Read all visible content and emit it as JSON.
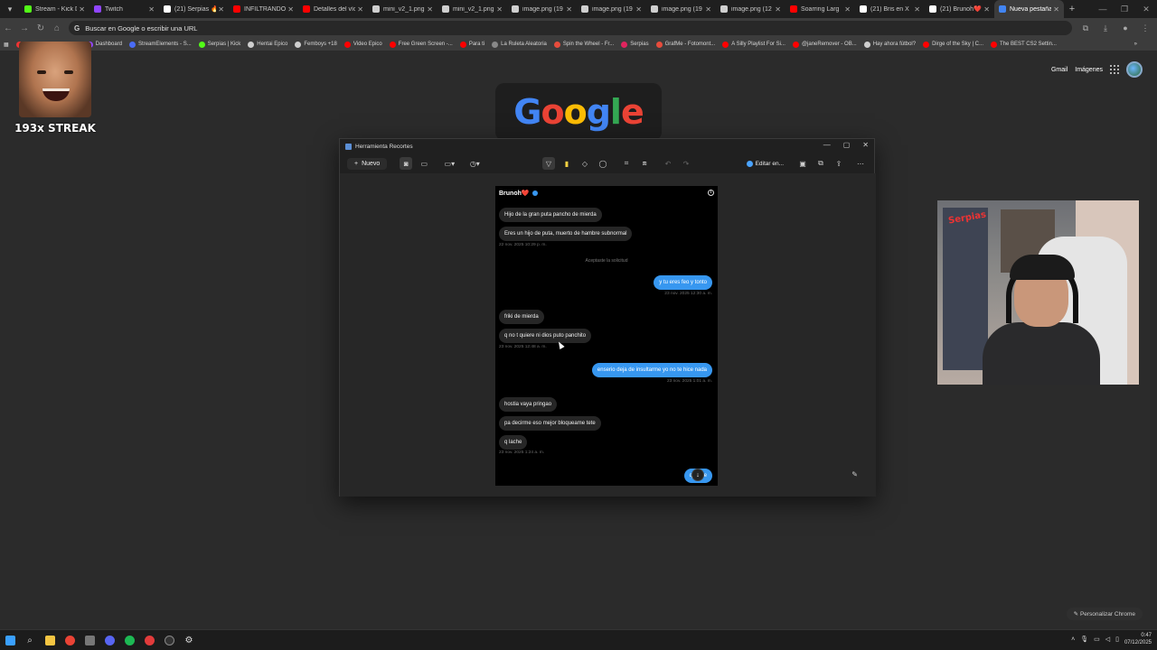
{
  "browser": {
    "tabs": [
      {
        "title": "Stream - Kick D",
        "color": "#53fc18",
        "active": false
      },
      {
        "title": "Twitch",
        "color": "#9146ff",
        "active": false
      },
      {
        "title": "(21) Serpias 🔥",
        "color": "#ffffff",
        "active": false
      },
      {
        "title": "INFILTRANDO",
        "color": "#ff0000",
        "active": false
      },
      {
        "title": "Detalles del víd",
        "color": "#ff0000",
        "active": false
      },
      {
        "title": "mini_v2_1.png",
        "color": "#cfcfcf",
        "active": false
      },
      {
        "title": "mini_v2_1.png",
        "color": "#cfcfcf",
        "active": false
      },
      {
        "title": "image.png (19",
        "color": "#cfcfcf",
        "active": false
      },
      {
        "title": "image.png (19",
        "color": "#cfcfcf",
        "active": false
      },
      {
        "title": "image.png (19",
        "color": "#cfcfcf",
        "active": false
      },
      {
        "title": "image.png (12",
        "color": "#cfcfcf",
        "active": false
      },
      {
        "title": "Soarring Larg",
        "color": "#ff0000",
        "active": false
      },
      {
        "title": "(21) Bris en X",
        "color": "#ffffff",
        "active": false
      },
      {
        "title": "(21) Brunoh❤️",
        "color": "#ffffff",
        "active": false
      },
      {
        "title": "Nueva pestaña",
        "color": "#4285f4",
        "active": true
      }
    ],
    "omnibox_placeholder": "Buscar en Google o escribir una URL",
    "bookmarks": [
      {
        "label": "Dashboard",
        "color": "#9146ff"
      },
      {
        "label": "StreamElements - S...",
        "color": "#4a6cf7"
      },
      {
        "label": "Serpias | Kick",
        "color": "#53fc18"
      },
      {
        "label": "Hentai Epico",
        "color": "#cfcfcf"
      },
      {
        "label": "Femboys +18",
        "color": "#cfcfcf"
      },
      {
        "label": "Video Epico",
        "color": "#ff0000"
      },
      {
        "label": "Free Green Screen -...",
        "color": "#ff0000"
      },
      {
        "label": "Para ti",
        "color": "#ff0000"
      },
      {
        "label": "La Ruleta Aleatoria",
        "color": "#888888"
      },
      {
        "label": "Spin the Wheel - Fr...",
        "color": "#e74c3c"
      },
      {
        "label": "Serpias",
        "color": "#e0245e"
      },
      {
        "label": "GrafMe - Fotomont...",
        "color": "#e74c3c"
      },
      {
        "label": "A Silly Playlist For Si...",
        "color": "#ff0000"
      },
      {
        "label": "@janeRemover - OB...",
        "color": "#ff0000"
      },
      {
        "label": "Hay ahora fútbol?",
        "color": "#cfcfcf"
      },
      {
        "label": "Dirge of the Sky | C...",
        "color": "#ff0000"
      },
      {
        "label": "The BEST CS2 Settin...",
        "color": "#ff0000"
      }
    ]
  },
  "ntp": {
    "gmail": "Gmail",
    "images": "Imágenes",
    "logo": "Google",
    "customize": "Personalizar Chrome"
  },
  "overlay": {
    "streak": "193x STREAK",
    "webcam_poster": "Serpias"
  },
  "snip": {
    "title": "Herramienta Recortes",
    "new_label": "Nuevo",
    "edit_label": "Editar en..."
  },
  "chat": {
    "username": "Brunoh❤️",
    "messages": [
      {
        "dir": "in",
        "text": "Hijo de la gran puta pancho de mierda"
      },
      {
        "dir": "in",
        "text": "Eres un hijo de puta, muerto de hambre subnormal"
      },
      {
        "dir": "ts",
        "text": "22 nov. 2025 10:29 p. m."
      },
      {
        "dir": "note",
        "text": "Aceptaste la solicitud"
      },
      {
        "dir": "out",
        "text": "y tu eres feo y tonto"
      },
      {
        "dir": "tsr",
        "text": "23 nov. 2025 12:30 a. m."
      },
      {
        "dir": "in",
        "text": "friki de mierda"
      },
      {
        "dir": "in",
        "text": "q no t quiere ni dios puto panchito"
      },
      {
        "dir": "ts",
        "text": "23 nov. 2025 12:48 a. m."
      },
      {
        "dir": "out",
        "text": "enserio deja de insultarme yo no te hice nada"
      },
      {
        "dir": "tsr",
        "text": "23 nov. 2025 1:01 a. m."
      },
      {
        "dir": "in",
        "text": "hostia vaya pringao"
      },
      {
        "dir": "in",
        "text": "pa decirme eso mejor bloqueame tete"
      },
      {
        "dir": "in",
        "text": "q lache"
      },
      {
        "dir": "ts",
        "text": "23 nov. 2025 1:24 a. m."
      },
      {
        "dir": "out",
        "text": "q lache"
      }
    ]
  },
  "taskbar": {
    "time": "0:47",
    "date": "07/12/2025"
  }
}
